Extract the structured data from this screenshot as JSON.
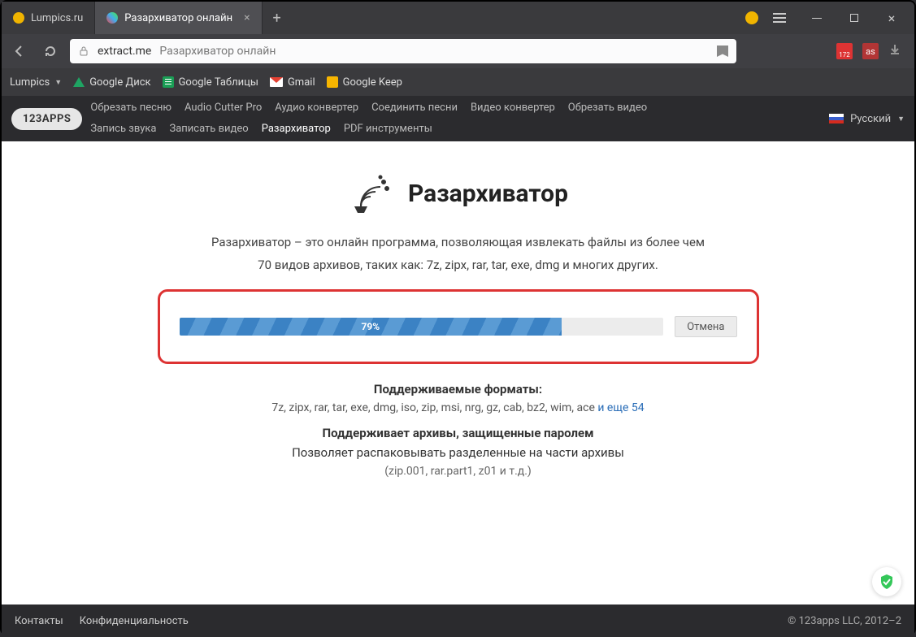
{
  "tabs": {
    "inactive": {
      "title": "Lumpics.ru"
    },
    "active": {
      "title": "Разархиватор онлайн"
    }
  },
  "url": {
    "domain": "extract.me",
    "title": "Разархиватор онлайн"
  },
  "toolbar_badge": "172",
  "lastfm_label": "as",
  "bookmarks": {
    "lumpics": "Lumpics",
    "drive": "Google Диск",
    "sheets": "Google Таблицы",
    "gmail": "Gmail",
    "keep": "Google Keep"
  },
  "site": {
    "logo": "123APPS",
    "links": [
      "Обрезать песню",
      "Audio Cutter Pro",
      "Аудио конвертер",
      "Соединить песни",
      "Видео конвертер",
      "Обрезать видео",
      "Запись звука",
      "Записать видео",
      "Разархиватор",
      "PDF инструменты"
    ],
    "current_index": 8,
    "lang": "Русский"
  },
  "hero": {
    "title": "Разархиватор"
  },
  "lead1": "Разархиватор – это онлайн программа, позволяющая извлекать файлы из более чем",
  "lead2": "70 видов архивов, таких как: 7z, zipx, rar, tar, exe, dmg и многих других.",
  "upload": {
    "progress_pct": 79,
    "progress_label": "79%",
    "cancel": "Отмена"
  },
  "formats": {
    "heading": "Поддерживаемые форматы:",
    "list": "7z, zipx, rar, tar, exe, dmg, iso, zip, msi, nrg, gz, cab, bz2, wim, ace ",
    "more": "и еще 54"
  },
  "p_password": "Поддерживает архивы, защищенные паролем",
  "p_split1": "Позволяет распаковывать разделенные на части архивы",
  "p_split2": "(zip.001, rar.part1, z01 и т.д.)",
  "footer": {
    "contacts": "Контакты",
    "privacy": "Конфиденциальность",
    "copyright": "© 123apps LLC, 2012–2"
  }
}
